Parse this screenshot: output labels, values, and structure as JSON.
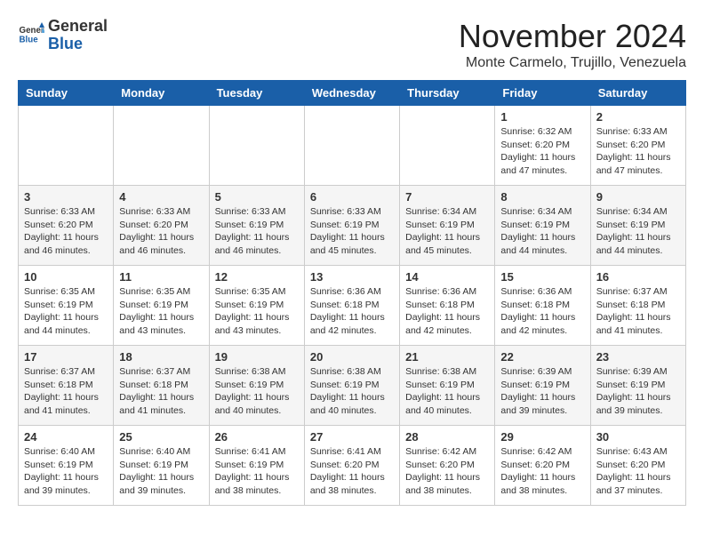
{
  "logo": {
    "general": "General",
    "blue": "Blue"
  },
  "title": "November 2024",
  "location": "Monte Carmelo, Trujillo, Venezuela",
  "days_of_week": [
    "Sunday",
    "Monday",
    "Tuesday",
    "Wednesday",
    "Thursday",
    "Friday",
    "Saturday"
  ],
  "weeks": [
    [
      {
        "day": "",
        "info": ""
      },
      {
        "day": "",
        "info": ""
      },
      {
        "day": "",
        "info": ""
      },
      {
        "day": "",
        "info": ""
      },
      {
        "day": "",
        "info": ""
      },
      {
        "day": "1",
        "info": "Sunrise: 6:32 AM\nSunset: 6:20 PM\nDaylight: 11 hours and 47 minutes."
      },
      {
        "day": "2",
        "info": "Sunrise: 6:33 AM\nSunset: 6:20 PM\nDaylight: 11 hours and 47 minutes."
      }
    ],
    [
      {
        "day": "3",
        "info": "Sunrise: 6:33 AM\nSunset: 6:20 PM\nDaylight: 11 hours and 46 minutes."
      },
      {
        "day": "4",
        "info": "Sunrise: 6:33 AM\nSunset: 6:20 PM\nDaylight: 11 hours and 46 minutes."
      },
      {
        "day": "5",
        "info": "Sunrise: 6:33 AM\nSunset: 6:19 PM\nDaylight: 11 hours and 46 minutes."
      },
      {
        "day": "6",
        "info": "Sunrise: 6:33 AM\nSunset: 6:19 PM\nDaylight: 11 hours and 45 minutes."
      },
      {
        "day": "7",
        "info": "Sunrise: 6:34 AM\nSunset: 6:19 PM\nDaylight: 11 hours and 45 minutes."
      },
      {
        "day": "8",
        "info": "Sunrise: 6:34 AM\nSunset: 6:19 PM\nDaylight: 11 hours and 44 minutes."
      },
      {
        "day": "9",
        "info": "Sunrise: 6:34 AM\nSunset: 6:19 PM\nDaylight: 11 hours and 44 minutes."
      }
    ],
    [
      {
        "day": "10",
        "info": "Sunrise: 6:35 AM\nSunset: 6:19 PM\nDaylight: 11 hours and 44 minutes."
      },
      {
        "day": "11",
        "info": "Sunrise: 6:35 AM\nSunset: 6:19 PM\nDaylight: 11 hours and 43 minutes."
      },
      {
        "day": "12",
        "info": "Sunrise: 6:35 AM\nSunset: 6:19 PM\nDaylight: 11 hours and 43 minutes."
      },
      {
        "day": "13",
        "info": "Sunrise: 6:36 AM\nSunset: 6:18 PM\nDaylight: 11 hours and 42 minutes."
      },
      {
        "day": "14",
        "info": "Sunrise: 6:36 AM\nSunset: 6:18 PM\nDaylight: 11 hours and 42 minutes."
      },
      {
        "day": "15",
        "info": "Sunrise: 6:36 AM\nSunset: 6:18 PM\nDaylight: 11 hours and 42 minutes."
      },
      {
        "day": "16",
        "info": "Sunrise: 6:37 AM\nSunset: 6:18 PM\nDaylight: 11 hours and 41 minutes."
      }
    ],
    [
      {
        "day": "17",
        "info": "Sunrise: 6:37 AM\nSunset: 6:18 PM\nDaylight: 11 hours and 41 minutes."
      },
      {
        "day": "18",
        "info": "Sunrise: 6:37 AM\nSunset: 6:18 PM\nDaylight: 11 hours and 41 minutes."
      },
      {
        "day": "19",
        "info": "Sunrise: 6:38 AM\nSunset: 6:19 PM\nDaylight: 11 hours and 40 minutes."
      },
      {
        "day": "20",
        "info": "Sunrise: 6:38 AM\nSunset: 6:19 PM\nDaylight: 11 hours and 40 minutes."
      },
      {
        "day": "21",
        "info": "Sunrise: 6:38 AM\nSunset: 6:19 PM\nDaylight: 11 hours and 40 minutes."
      },
      {
        "day": "22",
        "info": "Sunrise: 6:39 AM\nSunset: 6:19 PM\nDaylight: 11 hours and 39 minutes."
      },
      {
        "day": "23",
        "info": "Sunrise: 6:39 AM\nSunset: 6:19 PM\nDaylight: 11 hours and 39 minutes."
      }
    ],
    [
      {
        "day": "24",
        "info": "Sunrise: 6:40 AM\nSunset: 6:19 PM\nDaylight: 11 hours and 39 minutes."
      },
      {
        "day": "25",
        "info": "Sunrise: 6:40 AM\nSunset: 6:19 PM\nDaylight: 11 hours and 39 minutes."
      },
      {
        "day": "26",
        "info": "Sunrise: 6:41 AM\nSunset: 6:19 PM\nDaylight: 11 hours and 38 minutes."
      },
      {
        "day": "27",
        "info": "Sunrise: 6:41 AM\nSunset: 6:20 PM\nDaylight: 11 hours and 38 minutes."
      },
      {
        "day": "28",
        "info": "Sunrise: 6:42 AM\nSunset: 6:20 PM\nDaylight: 11 hours and 38 minutes."
      },
      {
        "day": "29",
        "info": "Sunrise: 6:42 AM\nSunset: 6:20 PM\nDaylight: 11 hours and 38 minutes."
      },
      {
        "day": "30",
        "info": "Sunrise: 6:43 AM\nSunset: 6:20 PM\nDaylight: 11 hours and 37 minutes."
      }
    ]
  ]
}
